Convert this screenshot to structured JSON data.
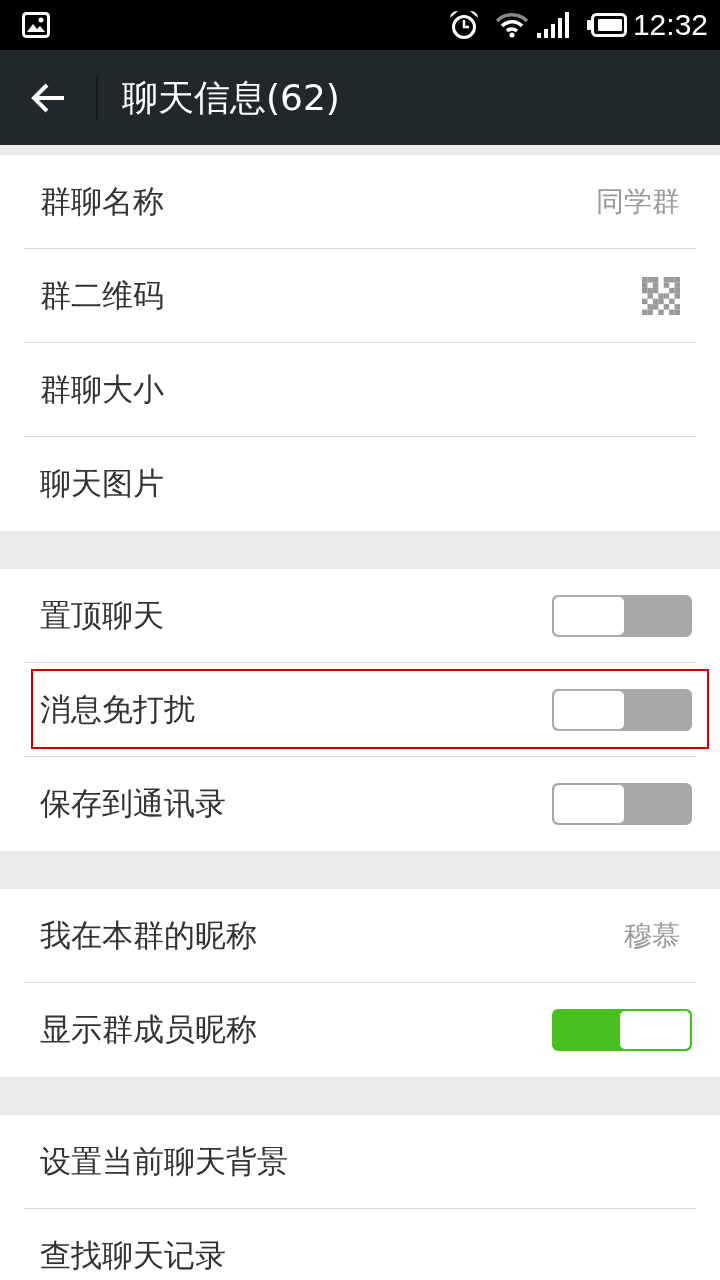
{
  "status_bar": {
    "time": "12:32"
  },
  "header": {
    "title": "聊天信息(62)"
  },
  "sections": [
    {
      "items": [
        {
          "kind": "value",
          "label": "群聊名称",
          "value": "同学群",
          "highlighted": false
        },
        {
          "kind": "qr",
          "label": "群二维码",
          "highlighted": false
        },
        {
          "kind": "plain",
          "label": "群聊大小",
          "highlighted": false
        },
        {
          "kind": "plain",
          "label": "聊天图片",
          "highlighted": false
        }
      ]
    },
    {
      "items": [
        {
          "kind": "toggle",
          "label": "置顶聊天",
          "on": false,
          "highlighted": false
        },
        {
          "kind": "toggle",
          "label": "消息免打扰",
          "on": false,
          "highlighted": true
        },
        {
          "kind": "toggle",
          "label": "保存到通讯录",
          "on": false,
          "highlighted": false
        }
      ]
    },
    {
      "items": [
        {
          "kind": "value",
          "label": "我在本群的昵称",
          "value": "穆慕",
          "highlighted": false
        },
        {
          "kind": "toggle",
          "label": "显示群成员昵称",
          "on": true,
          "highlighted": false
        }
      ]
    },
    {
      "items": [
        {
          "kind": "plain",
          "label": "设置当前聊天背景",
          "highlighted": false
        },
        {
          "kind": "plain",
          "label": "查找聊天记录",
          "highlighted": false
        }
      ]
    }
  ]
}
